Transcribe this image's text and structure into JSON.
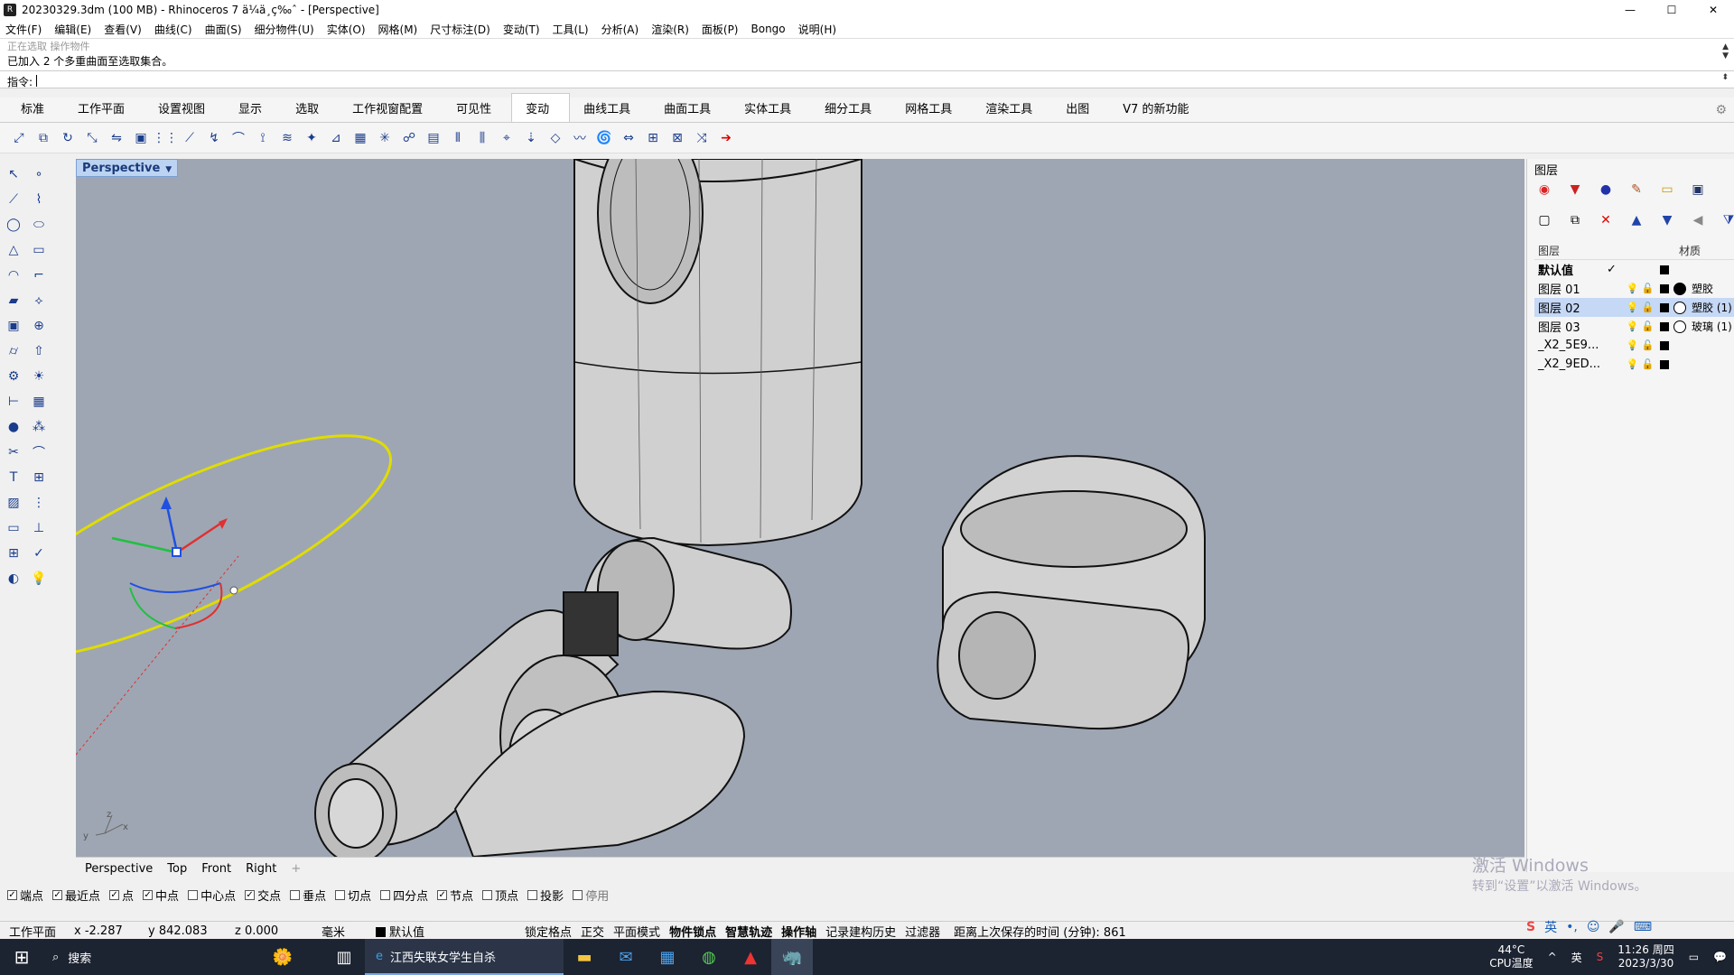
{
  "window": {
    "title": "20230329.3dm (100 MB) - Rhinoceros 7 ä¼ä¸ç‰ˆ - [Perspective]",
    "buttons": [
      "—",
      "☐",
      "✕"
    ]
  },
  "menu": [
    "文件(F)",
    "编辑(E)",
    "查看(V)",
    "曲线(C)",
    "曲面(S)",
    "细分物件(U)",
    "实体(O)",
    "网格(M)",
    "尺寸标注(D)",
    "变动(T)",
    "工具(L)",
    "分析(A)",
    "渲染(R)",
    "面板(P)",
    "Bongo",
    "说明(H)"
  ],
  "command": {
    "faded_line": "正在选取 操作物件",
    "history_line": "已加入 2 个多重曲面至选取集合。",
    "prompt_label": "指令:"
  },
  "tabs": [
    "标准",
    "工作平面",
    "设置视图",
    "显示",
    "选取",
    "工作视窗配置",
    "可见性",
    "变动",
    "曲线工具",
    "曲面工具",
    "实体工具",
    "细分工具",
    "网格工具",
    "渲染工具",
    "出图",
    "V7 的新功能"
  ],
  "active_tab": "变动",
  "toolbar_icons": [
    "move-icon",
    "copy-icon",
    "rotate-icon",
    "scale-icon",
    "mirror-icon",
    "box-icon",
    "array-icon",
    "shear-icon",
    "twist-icon",
    "bend-icon",
    "taper-icon",
    "flow-icon",
    "smart-icon",
    "orient-icon",
    "grid-array-icon",
    "polar-array-icon",
    "curve-array-icon",
    "surface-array-icon",
    "align-icon",
    "distribute-icon",
    "setpt-icon",
    "project-icon",
    "splop-icon",
    "flowalong-icon",
    "maelstrom-icon",
    "stretch-icon",
    "cage-icon",
    "cage-edit-icon",
    "remap-icon",
    "transform-arrow-icon"
  ],
  "viewport": {
    "name": "Perspective",
    "axis_labels": {
      "z": "z",
      "y": "y",
      "x": "x"
    }
  },
  "view_tabs": [
    "Perspective",
    "Top",
    "Front",
    "Right"
  ],
  "osnaps": [
    {
      "label": "端点",
      "checked": true
    },
    {
      "label": "最近点",
      "checked": true
    },
    {
      "label": "点",
      "checked": true
    },
    {
      "label": "中点",
      "checked": true
    },
    {
      "label": "中心点",
      "checked": false
    },
    {
      "label": "交点",
      "checked": true
    },
    {
      "label": "垂点",
      "checked": false
    },
    {
      "label": "切点",
      "checked": false
    },
    {
      "label": "四分点",
      "checked": false
    },
    {
      "label": "节点",
      "checked": true
    },
    {
      "label": "顶点",
      "checked": false
    },
    {
      "label": "投影",
      "checked": false
    },
    {
      "label": "停用",
      "checked": false
    }
  ],
  "status": {
    "cplane": "工作平面",
    "x": "x -2.287",
    "y": "y 842.083",
    "z": "z 0.000",
    "unit": "毫米",
    "layer": "默认值",
    "toggles": [
      "锁定格点",
      "正交",
      "平面模式",
      "物件锁点",
      "智慧轨迹",
      "操作轴",
      "记录建构历史",
      "过滤器"
    ],
    "bold_toggles": [
      "物件锁点",
      "智慧轨迹",
      "操作轴"
    ],
    "autosave": "距离上次保存的时间 (分钟): 861"
  },
  "layers_panel": {
    "title": "图层",
    "col_layer": "图层",
    "col_material": "材质",
    "rows": [
      {
        "name": "默认值",
        "current": true,
        "material": "",
        "mat_style": "none"
      },
      {
        "name": "图层 01",
        "current": false,
        "material": "塑胶",
        "mat_style": "dark"
      },
      {
        "name": "图层 02",
        "current": false,
        "material": "塑胶 (1)",
        "mat_style": "light",
        "selected": true
      },
      {
        "name": "图层 03",
        "current": false,
        "material": "玻璃 (1)",
        "mat_style": "light"
      },
      {
        "name": "_X2_5E9...",
        "current": false,
        "material": "",
        "mat_style": "none"
      },
      {
        "name": "_X2_9ED...",
        "current": false,
        "material": "",
        "mat_style": "none"
      }
    ]
  },
  "watermark": {
    "line1": "激活 Windows",
    "line2": "转到“设置”以激活 Windows。"
  },
  "taskbar": {
    "search": "搜索",
    "active_app": "江西失联女学生自杀",
    "weather_temp": "44°C",
    "weather_desc": "CPU温度",
    "ime": "英",
    "time": "11:26 周四",
    "date": "2023/3/30"
  },
  "colors": {
    "viewport_bg": "#9ea6b3",
    "accent": "#bcd3f2",
    "taskbar": "#1c2331"
  }
}
